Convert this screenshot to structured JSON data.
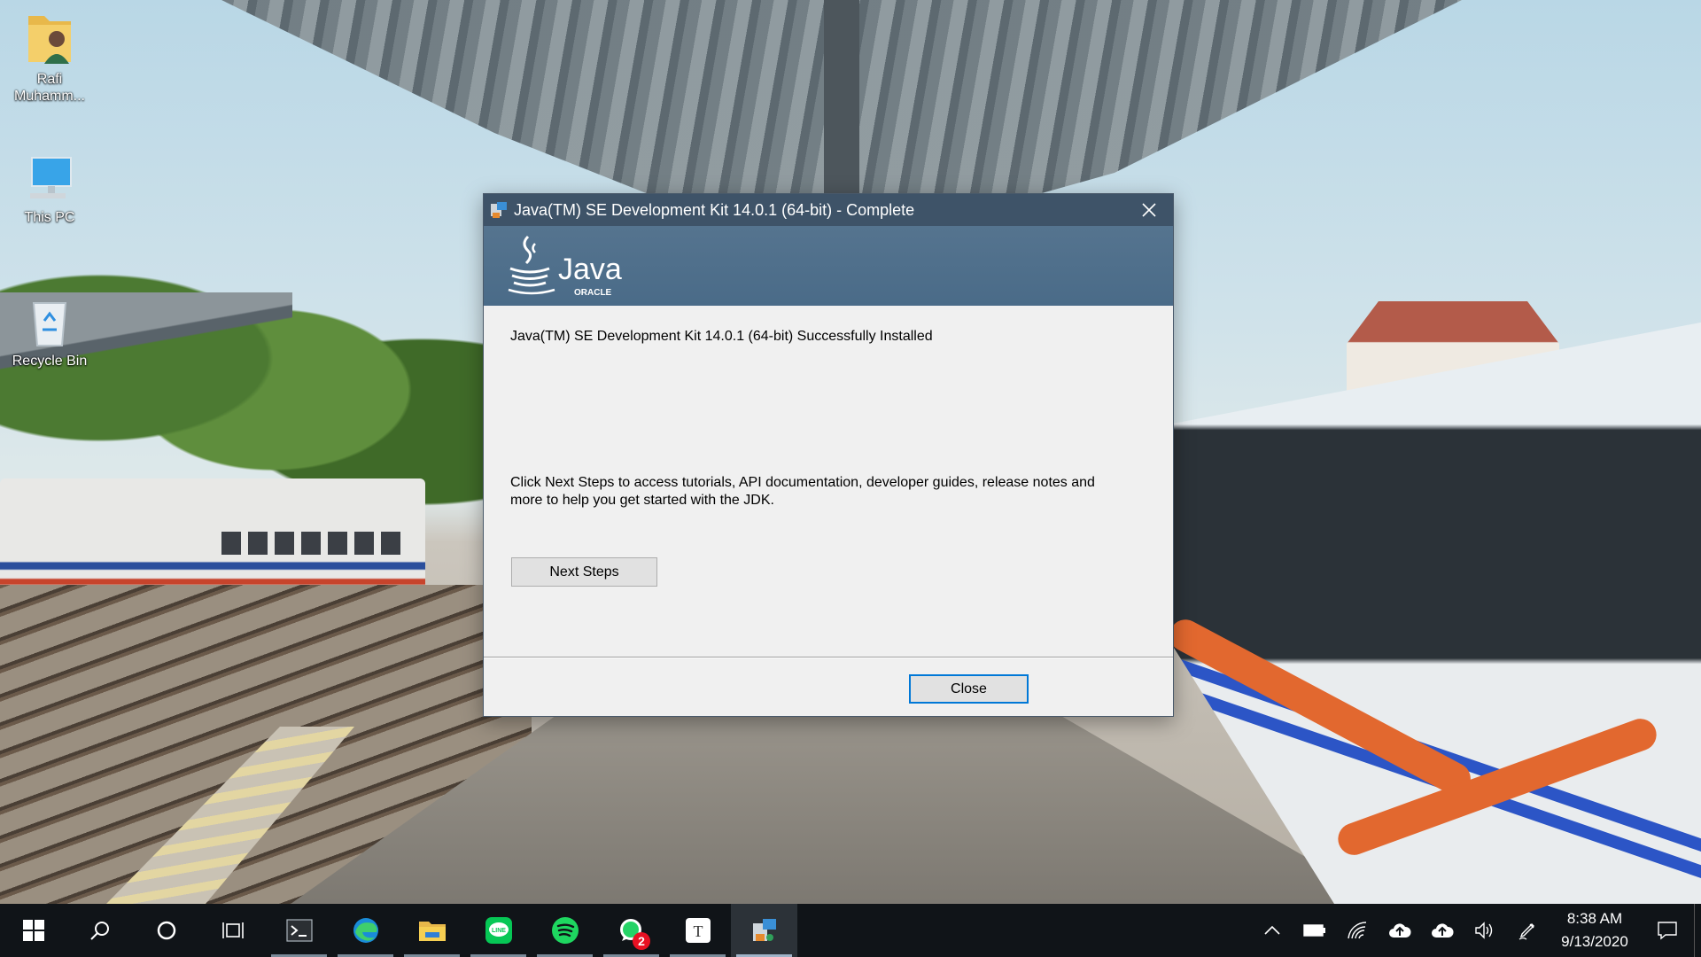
{
  "desktop": {
    "icons": [
      {
        "label": "Rafi\nMuhamm...",
        "icon": "user-folder-icon"
      },
      {
        "label": "This PC",
        "icon": "computer-icon"
      },
      {
        "label": "Recycle Bin",
        "icon": "recycle-bin-icon"
      }
    ]
  },
  "dialog": {
    "title": "Java(TM) SE Development Kit 14.0.1 (64-bit) - Complete",
    "banner_logo_text": "Java",
    "banner_logo_subtext": "ORACLE",
    "success_message": "Java(TM) SE Development Kit 14.0.1 (64-bit) Successfully Installed",
    "info_message": "Click Next Steps to access tutorials, API documentation, developer guides, release notes and more to help you get started with the JDK.",
    "next_steps_label": "Next Steps",
    "close_label": "Close"
  },
  "taskbar": {
    "items": [
      {
        "name": "start",
        "icon": "windows-logo-icon"
      },
      {
        "name": "search",
        "icon": "search-icon"
      },
      {
        "name": "cortana",
        "icon": "cortana-circle-icon"
      },
      {
        "name": "task-view",
        "icon": "task-view-icon"
      },
      {
        "name": "terminal",
        "icon": "terminal-icon"
      },
      {
        "name": "edge",
        "icon": "edge-browser-icon"
      },
      {
        "name": "file-explorer",
        "icon": "folder-icon"
      },
      {
        "name": "line",
        "icon": "line-app-icon"
      },
      {
        "name": "spotify",
        "icon": "spotify-icon"
      },
      {
        "name": "whatsapp",
        "icon": "whatsapp-icon",
        "badge": "2"
      },
      {
        "name": "typora",
        "icon": "typora-icon"
      },
      {
        "name": "java-installer",
        "icon": "installer-icon"
      }
    ],
    "tray": [
      "chevron-up-icon",
      "battery-icon",
      "wifi-icon",
      "cloud-upload-icon",
      "cloud-upload-icon",
      "volume-icon",
      "pen-icon"
    ],
    "time": "8:38 AM",
    "date": "9/13/2020"
  },
  "colors": {
    "titlebar": "#3e5368",
    "banner": "#55748f",
    "dialog_bg": "#f0f0f0",
    "accent": "#0078d7",
    "taskbar": "#101418"
  }
}
